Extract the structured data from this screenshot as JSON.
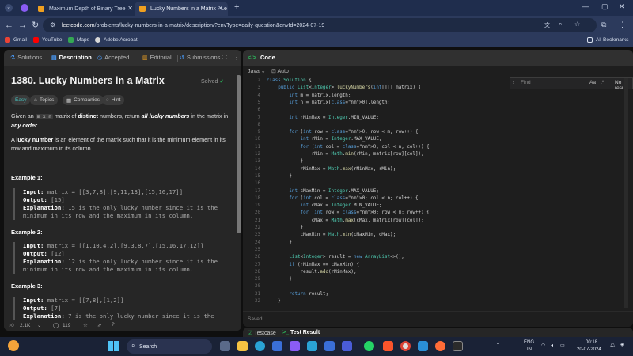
{
  "browser": {
    "tabs": [
      {
        "title": "Maximum Depth of Binary Tree",
        "active": false
      },
      {
        "title": "Lucky Numbers in a Matrix - Le",
        "active": true
      }
    ],
    "new_tab": "+",
    "url_host": "leetcode.com",
    "url_rest": "/problems/lucky-numbers-in-a-matrix/description/?envType=daily-question&envId=2024-07-19",
    "bookmarks": [
      "Gmail",
      "YouTube",
      "Maps",
      "Adobe Acrobat"
    ],
    "all_bookmarks": "All Bookmarks",
    "window_controls": [
      "—",
      "▢",
      "✕"
    ]
  },
  "left": {
    "tabs": [
      {
        "label": "Solutions",
        "icon": "flask-icon"
      },
      {
        "label": "Description",
        "icon": "document-icon"
      },
      {
        "label": "Accepted",
        "icon": "clock-icon"
      },
      {
        "label": "Editorial",
        "icon": "book-icon"
      },
      {
        "label": "Submissions",
        "icon": "history-icon"
      }
    ],
    "title": "1380. Lucky Numbers in a Matrix",
    "status": "Solved",
    "chips": [
      "Easy",
      "Topics",
      "Companies",
      "Hint"
    ],
    "desc1_a": "Given an ",
    "desc1_code": "m x n",
    "desc1_b": " matrix of ",
    "desc1_strong": "distinct",
    "desc1_c": " numbers, return ",
    "desc1_em": "all lucky numbers",
    "desc1_d": " in the matrix in ",
    "desc1_em2": "any order",
    "desc1_e": ".",
    "desc2_a": "A ",
    "desc2_strong": "lucky number",
    "desc2_b": " is an element of the matrix such that it is the minimum element in its row and maximum in its column.",
    "examples": [
      {
        "heading": "Example 1:",
        "input": "matrix = [[3,7,8],[9,11,13],[15,16,17]]",
        "output": "[15]",
        "explanation": "15 is the only lucky number since it is the minimum in its row and the maximum in its column."
      },
      {
        "heading": "Example 2:",
        "input": "matrix = [[1,10,4,2],[9,3,8,7],[15,16,17,12]]",
        "output": "[12]",
        "explanation": "12 is the only lucky number since it is the minimum in its row and the maximum in its column."
      },
      {
        "heading": "Example 3:",
        "input": "matrix = [[7,8],[1,2]]",
        "output": "[7]",
        "explanation": "7 is the only lucky number since it is the minimum in its row and the maximum in its column."
      }
    ],
    "labels": {
      "input": "Input:",
      "output": "Output:",
      "explanation": "Explanation:"
    },
    "likes": "2.1K",
    "comments": "119"
  },
  "right": {
    "header": "Code",
    "language": "Java",
    "auto": "Auto",
    "find_placeholder": "Find",
    "find_options": "Aa",
    "find_result": "No resu",
    "saved": "Saved",
    "bottom_tabs": [
      "Testcase",
      "Test Result"
    ],
    "code_lines": [
      "class Solution {",
      "    public List<Integer> luckyNumbers(int[][] matrix) {",
      "        int m = matrix.length;",
      "        int n = matrix[0].length;",
      "",
      "        int rMinMax = Integer.MIN_VALUE;",
      "",
      "        for (int row = 0; row < m; row++) {",
      "            int rMin = Integer.MAX_VALUE;",
      "            for (int col = 0; col < n; col++) {",
      "                rMin = Math.min(rMin, matrix[row][col]);",
      "            }",
      "            rMinMax = Math.max(rMinMax, rMin);",
      "        }",
      "",
      "        int cMaxMin = Integer.MAX_VALUE;",
      "        for (int col = 0; col < n; col++) {",
      "            int cMax = Integer.MIN_VALUE;",
      "            for (int row = 0; row < m; row++) {",
      "                cMax = Math.max(cMax, matrix[row][col]);",
      "            }",
      "            cMaxMin = Math.min(cMaxMin, cMax);",
      "        }",
      "",
      "        List<Integer> result = new ArrayList<>();",
      "        if (rMinMax == cMaxMin) {",
      "            result.add(rMinMax);",
      "        }",
      "",
      "        return result;",
      "    }"
    ],
    "first_line_number": 2
  },
  "taskbar": {
    "search": "Search",
    "lang": "ENG",
    "region": "IN",
    "time": "00:18",
    "date": "20-07-2024"
  }
}
